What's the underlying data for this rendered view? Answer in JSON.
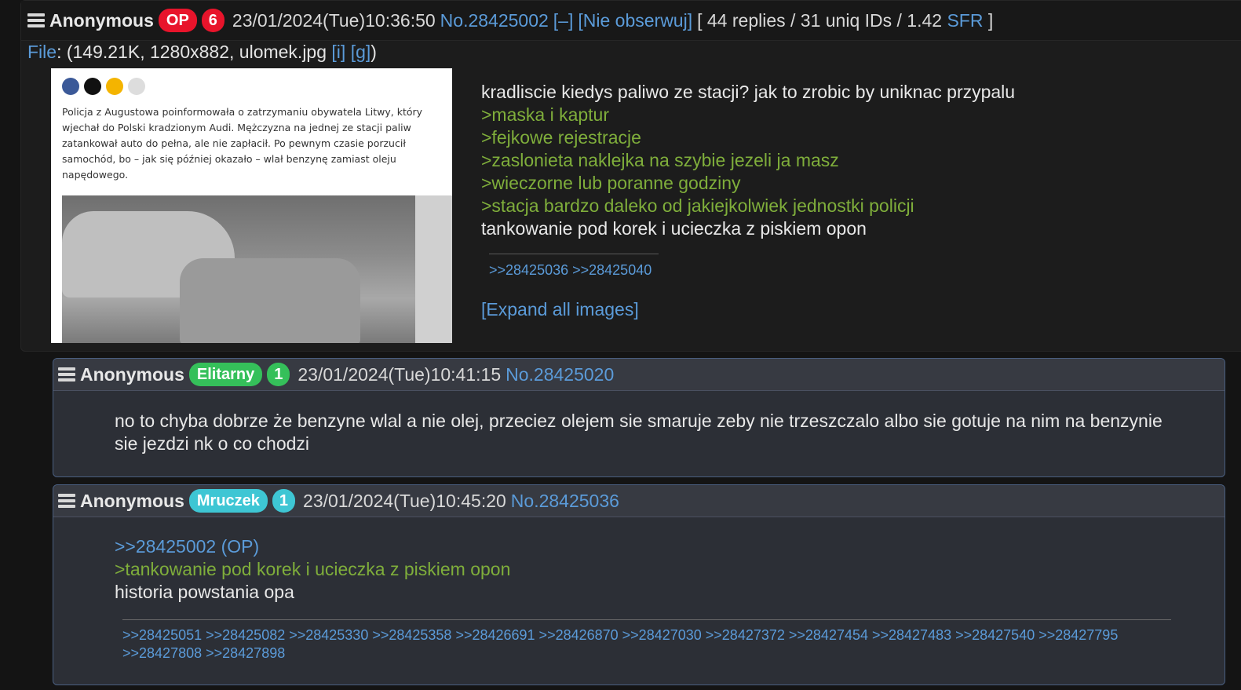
{
  "op": {
    "name": "Anonymous",
    "op_badge": "OP",
    "post_count": "6",
    "datetime": "23/01/2024(Tue)10:36:50",
    "number": "No.28425002",
    "collapse": "[–]",
    "unwatch": "[Nie obserwuj]",
    "stats_pre": "[ 44 replies / 31 uniq IDs / 1.42 ",
    "stats_sfr": "SFR",
    "stats_post": " ]",
    "file_label": "File",
    "file_info": ": (149.21K, 1280x882, ulomek.jpg ",
    "file_i": "[i]",
    "file_g": "[g]",
    "file_close": ")",
    "thumb_text": "Policja z Augustowa poinformowała o zatrzymaniu obywatela Litwy, który wjechał do Polski kradzionym Audi. Mężczyzna na jednej ze stacji paliw zatankował auto do pełna, ale nie zapłacił. Po pewnym czasie porzucił samochód, bo – jak się później okazało – wlał benzynę zamiast oleju napędowego.",
    "body_first": "kradliscie kiedys paliwo ze stacji? jak to zrobic by uniknac przypalu",
    "greentext": [
      ">maska i kaptur",
      ">fejkowe rejestracje",
      ">zaslonieta naklejka na szybie jezeli ja masz",
      ">wieczorne lub poranne godziny",
      ">stacja bardzo daleko od jakiejkolwiek jednostki policji"
    ],
    "body_last": "tankowanie pod korek i ucieczka z piskiem opon",
    "backlinks": ">>28425036 >>28425040",
    "expand": "[Expand all images]"
  },
  "reply1": {
    "name": "Anonymous",
    "tag": "Elitarny",
    "count": "1",
    "datetime": "23/01/2024(Tue)10:41:15",
    "number": "No.28425020",
    "body": "no to chyba dobrze że benzyne wlal a nie olej, przeciez olejem sie smaruje zeby nie trzeszczalo albo sie gotuje na nim na benzynie sie jezdzi nk o co chodzi"
  },
  "reply2": {
    "name": "Anonymous",
    "tag": "Mruczek",
    "count": "1",
    "datetime": "23/01/2024(Tue)10:45:20",
    "number": "No.28425036",
    "quote_link": ">>28425002 (OP)",
    "greentext": ">tankowanie pod korek i ucieczka z piskiem opon",
    "body": "historia powstania opa",
    "backlinks": ">>28425051 >>28425082 >>28425330 >>28425358 >>28426691 >>28426870 >>28427030 >>28427372 >>28427454 >>28427483 >>28427540 >>28427795 >>28427808 >>28427898"
  },
  "colors": {
    "link": "#5b9bd9",
    "greentext": "#7fae3b",
    "op_badge": "#e8142b",
    "elitarny": "#35c05a",
    "mruczek": "#3ec6d4"
  }
}
